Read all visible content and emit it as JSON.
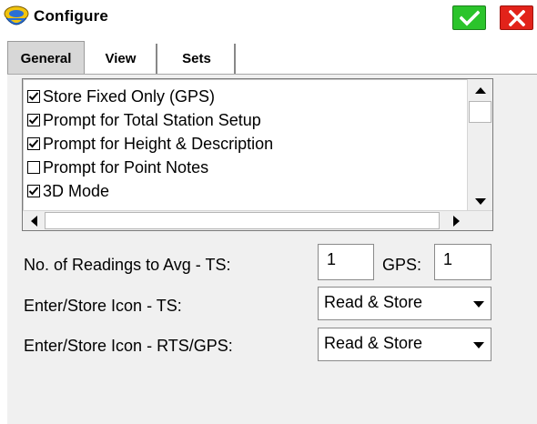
{
  "window": {
    "title": "Configure",
    "ok_icon": "checkmark-icon",
    "cancel_icon": "close-icon",
    "ok_color": "#2bc42b",
    "cancel_color": "#e2231a"
  },
  "tabs": [
    {
      "label": "General",
      "active": true
    },
    {
      "label": "View",
      "active": false
    },
    {
      "label": "Sets",
      "active": false
    }
  ],
  "options": [
    {
      "label": "Store Fixed Only (GPS)",
      "checked": true
    },
    {
      "label": "Prompt for Total Station Setup",
      "checked": true
    },
    {
      "label": "Prompt for Height & Description",
      "checked": true
    },
    {
      "label": "Prompt for Point Notes",
      "checked": false
    },
    {
      "label": "3D Mode",
      "checked": true
    }
  ],
  "readings": {
    "label": "No. of Readings to Avg  - TS:",
    "ts_value": "1",
    "gps_label": "GPS:",
    "gps_value": "1"
  },
  "enter_store_ts": {
    "label": "Enter/Store Icon - TS:",
    "value": "Read & Store"
  },
  "enter_store_rts": {
    "label": "Enter/Store Icon - RTS/GPS:",
    "value": "Read & Store"
  }
}
